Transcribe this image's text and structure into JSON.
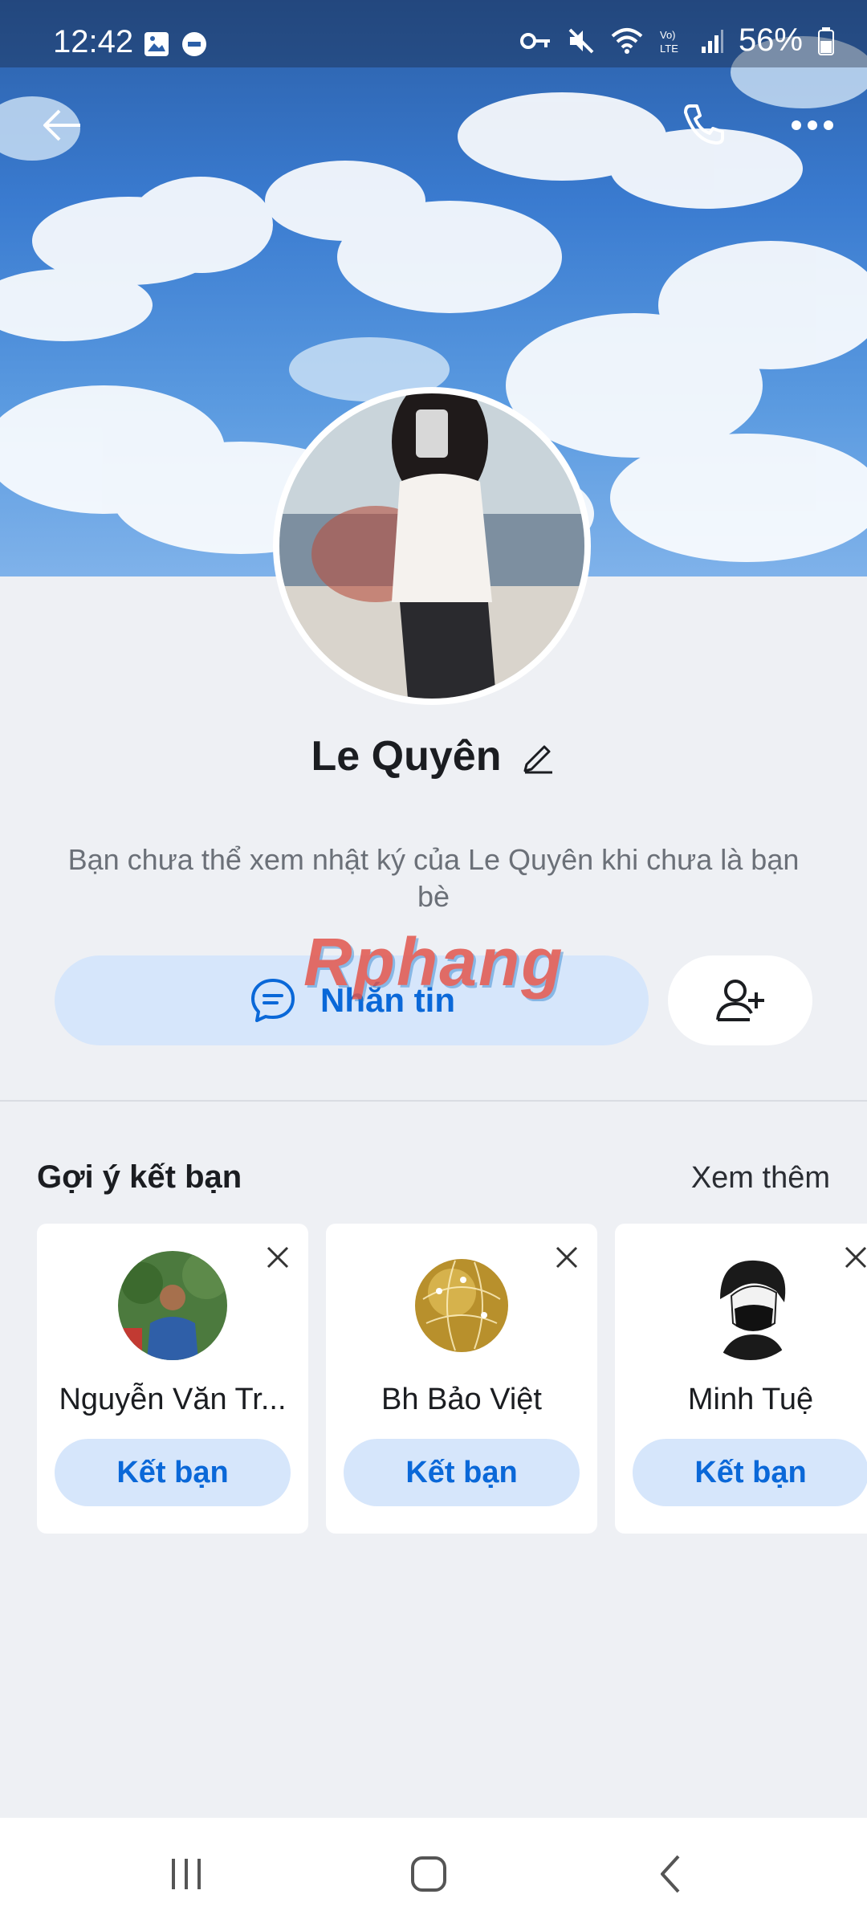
{
  "status_bar": {
    "time": "12:42",
    "battery": "56%",
    "icons": [
      "image-icon",
      "dnd-icon",
      "key-icon",
      "mute-icon",
      "wifi-icon",
      "volte-icon",
      "signal-icon",
      "battery-icon"
    ]
  },
  "header": {
    "back_icon": "back-arrow-icon",
    "call_icon": "phone-icon",
    "more_icon": "more-icon"
  },
  "profile": {
    "name": "Le Quyên",
    "edit_icon": "pencil-icon",
    "note": "Bạn chưa thể xem nhật ký của Le Quyên khi chưa là bạn bè"
  },
  "actions": {
    "message_label": "Nhắn tin",
    "add_friend_icon": "add-user-icon"
  },
  "watermark": "Rphang",
  "suggestions": {
    "title": "Gợi ý kết bạn",
    "see_more": "Xem thêm",
    "items": [
      {
        "name": "Nguyễn Văn Tr...",
        "button": "Kết bạn"
      },
      {
        "name": "Bh Bảo Việt",
        "button": "Kết bạn"
      },
      {
        "name": "Minh Tuệ",
        "button": "Kết bạn"
      }
    ]
  },
  "colors": {
    "accent": "#0a68d8",
    "button_bg": "#d6e6fb",
    "page_bg": "#eef0f4"
  }
}
